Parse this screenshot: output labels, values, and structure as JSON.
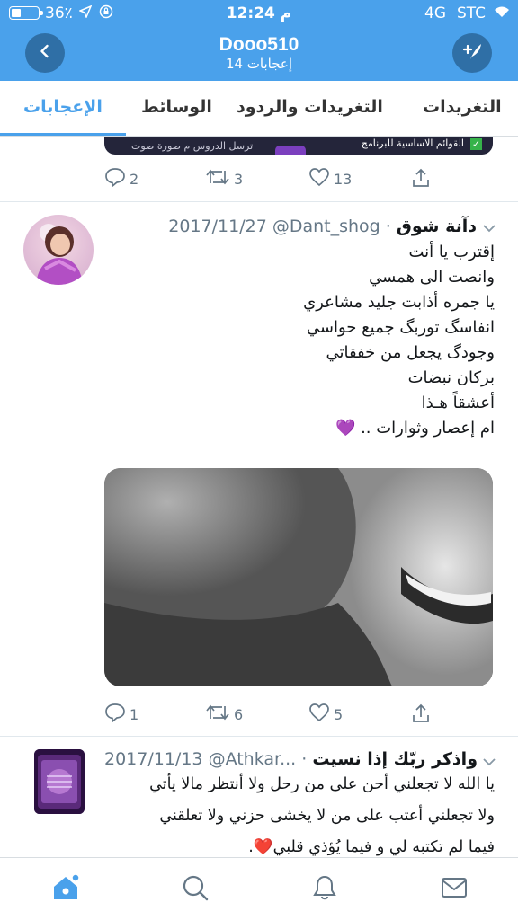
{
  "status_bar": {
    "battery": "36٪",
    "time": "12:24 م",
    "network": "4G",
    "carrier": "STC",
    "battery_level": 0.36
  },
  "header": {
    "title": "Dooo510",
    "subtitle": "14 إعجابات"
  },
  "tabs": [
    {
      "label": "التغريدات",
      "active": false
    },
    {
      "label": "التغريدات والردود",
      "active": false
    },
    {
      "label": "الوسائط",
      "active": false
    },
    {
      "label": "الإعجابات",
      "active": true
    }
  ],
  "prev_tweet": {
    "media_text_1": "القوائم الاساسية للبرنامج",
    "media_text_2": "ترسل الدروس م صورة صوت",
    "replies": "2",
    "retweets": "3",
    "likes": "13"
  },
  "tweet1": {
    "name": "دآنة شوق",
    "handle": "@Dant_shog",
    "date": "2017/11/27",
    "lines": [
      "إقترب يا أنت",
      "وانصت الى همسي",
      "يا جمره أذابت جليد مشاعري",
      "انفاسگ توربگ جميع حواسي",
      "وجودگ يجعل من خفقاتي",
      "بركان نبضات",
      "أعشقاً هـذا",
      "ام إعصار وثوارات .. 💜"
    ],
    "replies": "1",
    "retweets": "6",
    "likes": "5"
  },
  "tweet2": {
    "name": "واذكر ربّك إذا نسيت",
    "handle": "@Athkar...",
    "date": "2017/11/13",
    "lines": [
      "يا الله لا تجعلني أحن على من رحل ولا أنتظر مالا يأتي",
      "ولا تجعلني أعتب على من لا يخشى حزني ولا تعلقني",
      "فيما لم تكتبه لي و فيما يُؤذي قلبي❤️."
    ]
  },
  "icons": {
    "back": "chevron-left-icon",
    "compose": "compose-tweet-icon",
    "reply": "reply-icon",
    "retweet": "retweet-icon",
    "like": "heart-icon",
    "share": "share-icon",
    "home": "home-icon",
    "search": "search-icon",
    "notifications": "bell-icon",
    "messages": "mail-icon"
  },
  "colors": {
    "brand": "#4aa1eb",
    "header_button": "#2f6fa6",
    "muted": "#657786",
    "text": "#14171a"
  }
}
